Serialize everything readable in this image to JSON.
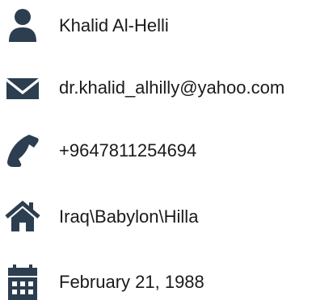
{
  "theme": {
    "icon_color": "#2c3e50",
    "text_color": "#1a1a1a",
    "background": "#ffffff"
  },
  "contact": {
    "items": [
      {
        "icon": "user-icon",
        "text": "Khalid Al-Helli"
      },
      {
        "icon": "envelope-icon",
        "text": "dr.khalid_alhilly@yahoo.com"
      },
      {
        "icon": "phone-icon",
        "text": "+9647811254694"
      },
      {
        "icon": "home-icon",
        "text": "Iraq\\Babylon\\Hilla"
      },
      {
        "icon": "calendar-icon",
        "text": "February 21, 1988"
      }
    ]
  }
}
